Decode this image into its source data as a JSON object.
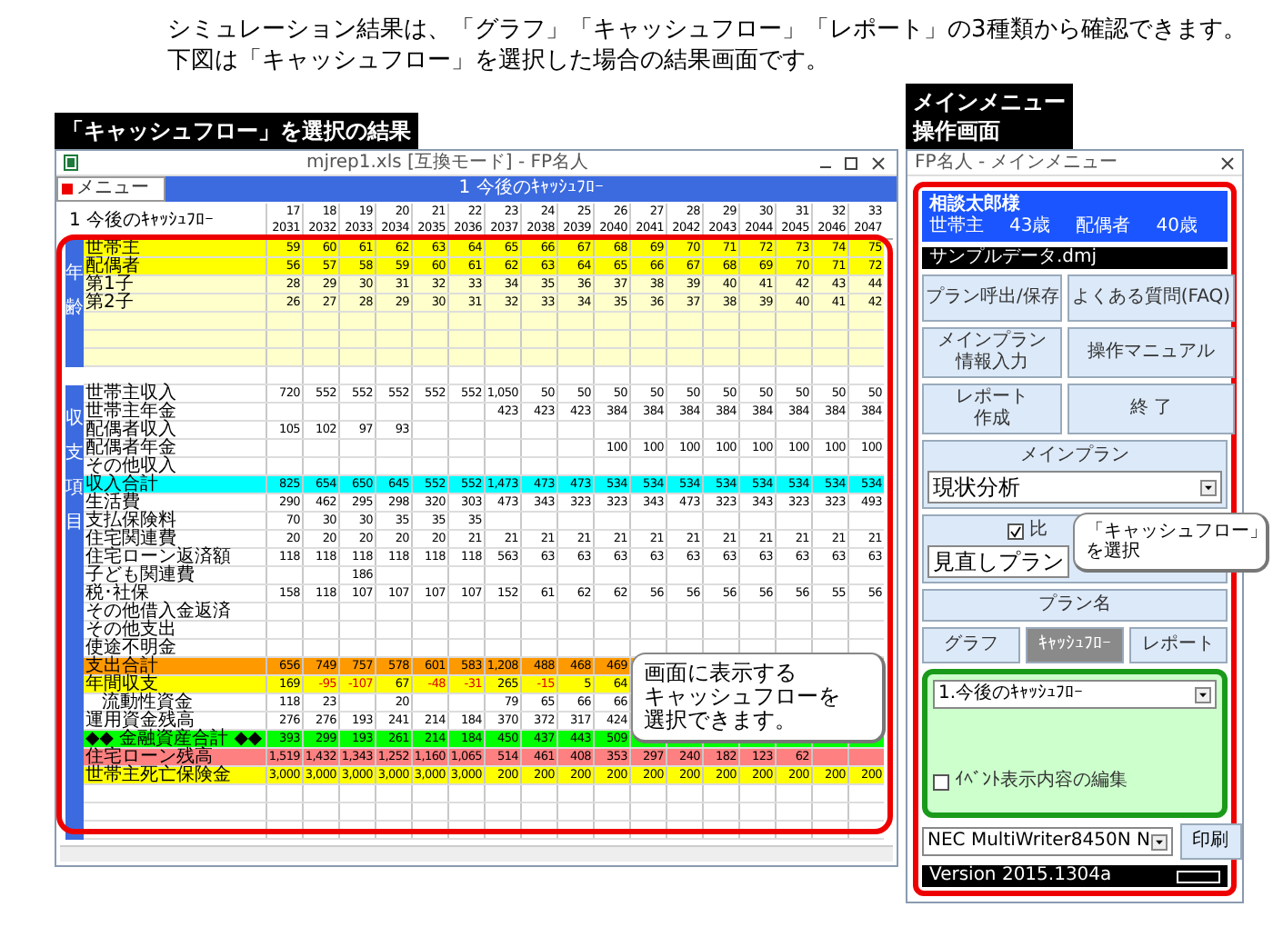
{
  "intro": [
    "シミュレーション結果は、「グラフ」「キャッシュフロー」「レポート」の3種類から確認できます。",
    "下図は「キャッシュフロー」を選択した場合の結果画面です。"
  ],
  "sheet_label": "「キャッシュフロー」を選択の結果",
  "menu_label": [
    "メインメニュー",
    "操作画面"
  ],
  "sheet": {
    "title": "mjrep1.xls [互換モード] - FP名人",
    "menu_button": "メニュー",
    "header": "1 今後のｷｬｯｼｭﾌﾛｰ",
    "table_title": "1 今後のｷｬｯｼｭﾌﾛｰ",
    "callout": [
      "画面に表示する",
      "キャッシュフローを",
      "選択できます。"
    ],
    "columns": [
      {
        "index": "17",
        "year": "2031"
      },
      {
        "index": "18",
        "year": "2032"
      },
      {
        "index": "19",
        "year": "2033"
      },
      {
        "index": "20",
        "year": "2034"
      },
      {
        "index": "21",
        "year": "2035"
      },
      {
        "index": "22",
        "year": "2036"
      },
      {
        "index": "23",
        "year": "2037"
      },
      {
        "index": "24",
        "year": "2038"
      },
      {
        "index": "25",
        "year": "2039"
      },
      {
        "index": "26",
        "year": "2040"
      },
      {
        "index": "27",
        "year": "2041"
      },
      {
        "index": "28",
        "year": "2042"
      },
      {
        "index": "29",
        "year": "2043"
      },
      {
        "index": "30",
        "year": "2044"
      },
      {
        "index": "31",
        "year": "2045"
      },
      {
        "index": "32",
        "year": "2046"
      },
      {
        "index": "33",
        "year": "2047"
      }
    ],
    "sections": [
      {
        "side_label": "年齢",
        "rows": [
          {
            "label": "世帯主",
            "color": "#ffff00",
            "values": [
              "59",
              "60",
              "61",
              "62",
              "63",
              "64",
              "65",
              "66",
              "67",
              "68",
              "69",
              "70",
              "71",
              "72",
              "73",
              "74",
              "75"
            ]
          },
          {
            "label": "配偶者",
            "color": "#ffff00",
            "values": [
              "56",
              "57",
              "58",
              "59",
              "60",
              "61",
              "62",
              "63",
              "64",
              "65",
              "66",
              "67",
              "68",
              "69",
              "70",
              "71",
              "72"
            ]
          },
          {
            "label": "第1子",
            "color": "#ffffcc",
            "values": [
              "28",
              "29",
              "30",
              "31",
              "32",
              "33",
              "34",
              "35",
              "36",
              "37",
              "38",
              "39",
              "40",
              "41",
              "42",
              "43",
              "44"
            ]
          },
          {
            "label": "第2子",
            "color": "#ffffcc",
            "values": [
              "26",
              "27",
              "28",
              "29",
              "30",
              "31",
              "32",
              "33",
              "34",
              "35",
              "36",
              "37",
              "38",
              "39",
              "40",
              "41",
              "42"
            ]
          },
          {
            "color": "#ffffcc"
          },
          {
            "color": "#ffffcc"
          },
          {
            "color": "#ffffcc"
          }
        ]
      },
      {
        "side_label": "収支項目",
        "rows": [
          {
            "label": "世帯主収入",
            "values": [
              "720",
              "552",
              "552",
              "552",
              "552",
              "552",
              "1,050",
              "50",
              "50",
              "50",
              "50",
              "50",
              "50",
              "50",
              "50",
              "50",
              "50"
            ]
          },
          {
            "label": "世帯主年金",
            "values": [
              {
                "kind": "blank"
              },
              {
                "kind": "blank"
              },
              {
                "kind": "blank"
              },
              {
                "kind": "blank"
              },
              {
                "kind": "blank"
              },
              {
                "kind": "blank"
              },
              "423",
              "423",
              "423",
              "384",
              "384",
              "384",
              "384",
              "384",
              "384",
              "384",
              "384"
            ]
          },
          {
            "label": "配偶者収入",
            "values": [
              "105",
              "102",
              "97",
              "93"
            ]
          },
          {
            "label": "配偶者年金",
            "values": [
              {
                "kind": "blank"
              },
              {
                "kind": "blank"
              },
              {
                "kind": "blank"
              },
              {
                "kind": "blank"
              },
              {
                "kind": "blank"
              },
              {
                "kind": "blank"
              },
              {
                "kind": "blank"
              },
              {
                "kind": "blank"
              },
              {
                "kind": "blank"
              },
              "100",
              "100",
              "100",
              "100",
              "100",
              "100",
              "100",
              "100"
            ]
          },
          {
            "label": "その他収入"
          },
          {
            "label": "収入合計",
            "color": "#00ffff",
            "values": [
              "825",
              "654",
              "650",
              "645",
              "552",
              "552",
              "1,473",
              "473",
              "473",
              "534",
              "534",
              "534",
              "534",
              "534",
              "534",
              "534",
              "534"
            ]
          },
          {
            "label": "生活費",
            "values": [
              "290",
              "462",
              "295",
              "298",
              "320",
              "303",
              "473",
              "343",
              "323",
              "323",
              "343",
              "473",
              "323",
              "343",
              "323",
              "323",
              "493"
            ]
          },
          {
            "label": "支払保険料",
            "values": [
              "70",
              "30",
              "30",
              "35",
              "35",
              "35"
            ]
          },
          {
            "label": "住宅関連費",
            "values": [
              "20",
              "20",
              "20",
              "20",
              "20",
              "21",
              "21",
              "21",
              "21",
              "21",
              "21",
              "21",
              "21",
              "21",
              "21",
              "21",
              "21"
            ]
          },
          {
            "label": "住宅ローン返済額",
            "values": [
              "118",
              "118",
              "118",
              "118",
              "118",
              "118",
              "563",
              "63",
              "63",
              "63",
              "63",
              "63",
              "63",
              "63",
              "63",
              "63",
              "63"
            ]
          },
          {
            "label": "子ども関連費",
            "values": [
              {
                "kind": "blank"
              },
              {
                "kind": "blank"
              },
              "186"
            ]
          },
          {
            "label": "税･社保",
            "values": [
              "158",
              "118",
              "107",
              "107",
              "107",
              "107",
              "152",
              "61",
              "62",
              "62",
              "56",
              "56",
              "56",
              "56",
              "56",
              "55",
              "56"
            ]
          },
          {
            "label": "その他借入金返済"
          },
          {
            "label": "その他支出"
          },
          {
            "label": "使途不明金"
          },
          {
            "label": "支出合計",
            "color": "#ff9900",
            "values": [
              "656",
              "749",
              "757",
              "578",
              "601",
              "583",
              "1,208",
              "488",
              "468",
              "469"
            ]
          },
          {
            "label": "年間収支",
            "color": "#ffff00",
            "values": [
              "169",
              {
                "text": "-95",
                "negative": true
              },
              {
                "text": "-107",
                "negative": true
              },
              "67",
              {
                "text": "-48",
                "negative": true
              },
              {
                "text": "-31",
                "negative": true
              },
              "265",
              {
                "text": "-15",
                "negative": true
              },
              "5",
              "64"
            ]
          },
          {
            "label": "流動性資金",
            "indented": true,
            "values": [
              "118",
              "23",
              {
                "kind": "blank"
              },
              "20",
              {
                "kind": "blank"
              },
              {
                "kind": "blank"
              },
              "79",
              "65",
              "66",
              "66"
            ]
          },
          {
            "label": "運用資金残高",
            "values": [
              "276",
              "276",
              "193",
              "241",
              "214",
              "184",
              "370",
              "372",
              "317",
              "424"
            ]
          },
          {
            "label": "◆◆ 金融資産合計 ◆◆",
            "color": "#00ff00",
            "values": [
              "393",
              "299",
              "193",
              "261",
              "214",
              "184",
              "450",
              "437",
              "443",
              "509"
            ]
          },
          {
            "label": "住宅ローン残高",
            "color": "#ff8080",
            "values": [
              "1,519",
              "1,432",
              "1,343",
              "1,252",
              "1,160",
              "1,065",
              "514",
              "461",
              "408",
              "353",
              "297",
              "240",
              "182",
              "123",
              "62"
            ]
          },
          {
            "label": "世帯主死亡保険金",
            "color": "#ffff00",
            "values": [
              "3,000",
              "3,000",
              "3,000",
              "3,000",
              "3,000",
              "3,000",
              "200",
              "200",
              "200",
              "200",
              "200",
              "200",
              "200",
              "200",
              "200",
              "200",
              "200"
            ]
          }
        ]
      }
    ]
  },
  "menu": {
    "title": "FP名人 - メインメニュー",
    "client_name": "相談太郎様",
    "household": [
      {
        "label": "世帯主",
        "age": "43歳"
      },
      {
        "label": "配偶者",
        "age": "40歳"
      }
    ],
    "data_file": "サンプルデータ.dmj",
    "buttons": [
      [
        "プラン呼出/保存"
      ],
      [
        "よくある質問(FAQ)"
      ],
      [
        "メインプラン",
        "情報入力"
      ],
      [
        "操作マニュアル"
      ],
      [
        "レポート",
        "作成"
      ],
      [
        "終 了"
      ]
    ],
    "main_plan": {
      "label": "メインプラン",
      "value": "現状分析"
    },
    "compare": {
      "label": "比",
      "checked": true,
      "value": "見直しプラン"
    },
    "plan_name_button": "プラン名",
    "callout": [
      "「キャッシュフロー」",
      "を選択"
    ],
    "tabs": [
      {
        "label": "グラフ",
        "selected": false
      },
      {
        "label": "ｷｬｯｼｭﾌﾛｰ",
        "selected": true
      },
      {
        "label": "レポート",
        "selected": false
      }
    ],
    "view_select": "1.今後のｷｬｯｼｭﾌﾛｰ",
    "event_checkbox": {
      "label": "ｲﾍﾞﾝﾄ表示内容の編集",
      "checked": false
    },
    "printer": "NEC MultiWriter8450N N",
    "print_button": "印刷",
    "version": "Version 2015.1304a"
  }
}
